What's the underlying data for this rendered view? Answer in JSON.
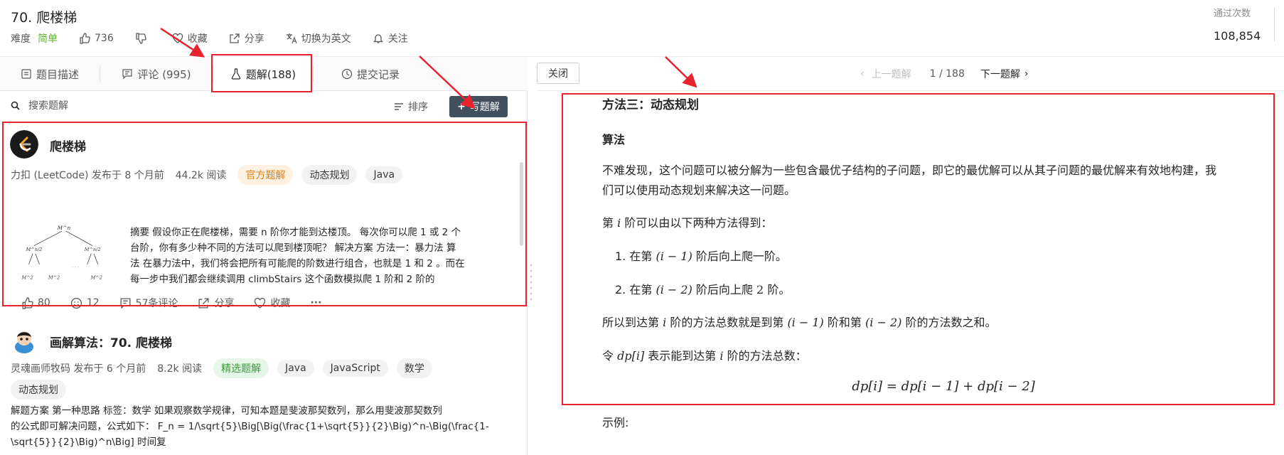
{
  "header": {
    "title": "70. 爬楼梯",
    "difficulty_label": "难度",
    "difficulty_value": "简单",
    "likes": "736",
    "favorite_label": "收藏",
    "share_label": "分享",
    "translate_label": "切换为英文",
    "follow_label": "关注",
    "stats_label": "通过次数",
    "stats_value": "108,854"
  },
  "tabs": [
    {
      "label": "题目描述"
    },
    {
      "label": "评论 (995)"
    },
    {
      "label": "题解(188)"
    },
    {
      "label": "提交记录"
    }
  ],
  "search": {
    "placeholder": "搜索题解",
    "sort_label": "排序",
    "write_label": "写题解"
  },
  "solutions": [
    {
      "title": "爬楼梯",
      "author": "力扣 (LeetCode) 发布于 8 个月前",
      "reads": "44.2k 阅读",
      "tags": [
        "官方题解",
        "动态规划",
        "Java"
      ],
      "summary_lines": [
        "摘要 假设你正在爬楼梯，需要 n 阶你才能到达楼顶。 每次你可以爬 1 或 2 个",
        "台阶，你有多少种不同的方法可以爬到楼顶呢？ 解决方案 方法一：暴力法 算",
        "法 在暴力法中，我们将会把所有可能爬的阶数进行组合，也就是 1 和 2 。而在",
        "每一步中我们都会继续调用 climbStairs 这个函数模拟爬 1 阶和 2 阶的"
      ],
      "likes": "80",
      "reactions": "12",
      "comments": "57条评论",
      "share": "分享",
      "favorite": "收藏",
      "more": "···",
      "thumb_labels": [
        "M^n",
        "M^n/2",
        "M^n/2",
        "· · ·",
        "M^2",
        "M^2",
        "M^2"
      ]
    },
    {
      "title": "画解算法：70. 爬楼梯",
      "author": "灵魂画师牧码 发布于 6 个月前",
      "reads": "8.2k 阅读",
      "tags": [
        "精选题解",
        "Java",
        "JavaScript",
        "数学",
        "动态规划"
      ],
      "summary_lines": [
        "解题方案 第一种思路 标签：数学 如果观察数学规律，可知本题是斐波那契数列，那么用斐波那契数列",
        "的公式即可解决问题，公式如下： F_n = 1/\\sqrt{5}\\Big[\\Big(\\frac{1+\\sqrt{5}}{2}\\Big)^n-\\Big(\\frac{1-",
        "\\sqrt{5}}{2}\\Big)^n\\Big] 时间复"
      ]
    }
  ],
  "right_bar": {
    "close_label": "关闭",
    "prev_label": "上一题解",
    "page": "1 / 188",
    "next_label": "下一题解"
  },
  "article": {
    "heading": "方法三：动态规划",
    "subheading": "算法",
    "p1_line1": "不难发现，这个问题可以被分解为一些包含最优子结构的子问题，即它的最优解可以从其子问题的最优解来有效地构建，我",
    "p1_line2": "们可以使用动态规划来解决这一问题。",
    "p2_a": "第",
    "p2_var": "i",
    "p2_b": "阶可以由以下两种方法得到：",
    "li1_a": "在第",
    "li1_math": "(i − 1)",
    "li1_b": "阶后向上爬一阶。",
    "li2_a": "在第",
    "li2_math": "(i − 2)",
    "li2_b": "阶后向上爬",
    "li2_num": "2",
    "li2_c": "阶。",
    "p3_a": "所以到达第",
    "p3_var": "i",
    "p3_b": "阶的方法总数就是到第",
    "p3_m1": "(i − 1)",
    "p3_c": "阶和第",
    "p3_m2": "(i − 2)",
    "p3_d": "阶的方法数之和。",
    "p4_a": "令",
    "p4_math": "dp[i]",
    "p4_b": "表示能到达第",
    "p4_var": "i",
    "p4_c": "阶的方法总数：",
    "formula": "dp[i] = dp[i − 1] + dp[i − 2]",
    "example_label": "示例:"
  },
  "colors": {
    "accent_green": "#5ab726",
    "annotation_red": "#e8232e",
    "write_button": "#42505e",
    "official_tag": "#e37f13"
  }
}
